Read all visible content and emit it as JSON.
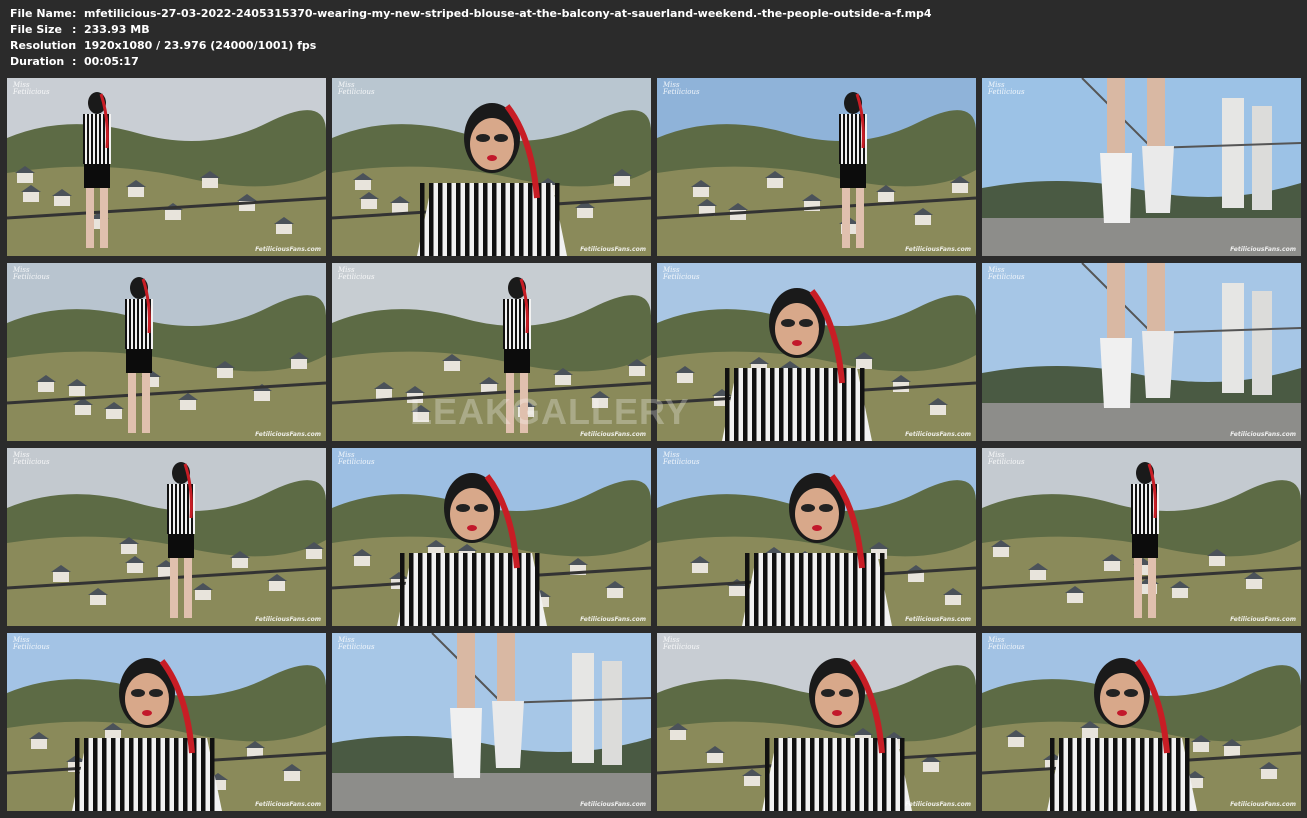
{
  "info": {
    "file_name": {
      "key": "File Name",
      "value": "mfetilicious-27-03-2022-2405315370-wearing-my-new-striped-blouse-at-the-balcony-at-sauerland-weekend.-the-people-outside-a-f.mp4"
    },
    "file_size": {
      "key": "File Size",
      "value": "233.93 MB"
    },
    "resolution": {
      "key": "Resolution",
      "value": "1920x1080 / 23.976 (24000/1001) fps"
    },
    "duration": {
      "key": "Duration",
      "value": "00:05:17"
    }
  },
  "colon": ":",
  "overlay_watermark": "LEAKGALLERY",
  "thumbnails": [
    {
      "scene": "village-wide",
      "logo": "Miss Fetilicious",
      "watermark": "FetiliciousFans.com",
      "sky": "#c9ced4"
    },
    {
      "scene": "closeup-face",
      "logo": "Miss Fetilicious",
      "watermark": "FetiliciousFans.com",
      "sky": "#b9c6d0"
    },
    {
      "scene": "standing-mid",
      "logo": "Miss Fetilicious",
      "watermark": "FetiliciousFans.com",
      "sky": "#8fb3d9"
    },
    {
      "scene": "heels-closeup",
      "logo": "Miss Fetilicious",
      "watermark": "FetiliciousFans.com",
      "sky": "#9cc2e6"
    },
    {
      "scene": "village-wide",
      "logo": "Miss Fetilicious",
      "watermark": "FetiliciousFans.com",
      "sky": "#b8c4cf"
    },
    {
      "scene": "village-wide",
      "logo": "Miss Fetilicious",
      "watermark": "FetiliciousFans.com",
      "sky": "#c7cdd2"
    },
    {
      "scene": "closeup-face",
      "logo": "Miss Fetilicious",
      "watermark": "FetiliciousFans.com",
      "sky": "#a9c6e4"
    },
    {
      "scene": "heels-closeup",
      "logo": "Miss Fetilicious",
      "watermark": "FetiliciousFans.com",
      "sky": "#a6c6e6"
    },
    {
      "scene": "village-wide",
      "logo": "Miss Fetilicious",
      "watermark": "FetiliciousFans.com",
      "sky": "#c3c9cf"
    },
    {
      "scene": "closeup-face",
      "logo": "Miss Fetilicious",
      "watermark": "FetiliciousFans.com",
      "sky": "#9dbfe3"
    },
    {
      "scene": "closeup-face",
      "logo": "Miss Fetilicious",
      "watermark": "FetiliciousFans.com",
      "sky": "#9ebfe2"
    },
    {
      "scene": "village-wide",
      "logo": "Miss Fetilicious",
      "watermark": "FetiliciousFans.com",
      "sky": "#c4cad0"
    },
    {
      "scene": "closeup-face",
      "logo": "Miss Fetilicious",
      "watermark": "FetiliciousFans.com",
      "sky": "#a3c3e5"
    },
    {
      "scene": "heels-closeup",
      "logo": "Miss Fetilicious",
      "watermark": "FetiliciousFans.com",
      "sky": "#a7c7e7"
    },
    {
      "scene": "closeup-face",
      "logo": "Miss Fetilicious",
      "watermark": "FetiliciousFans.com",
      "sky": "#c8cdd3"
    },
    {
      "scene": "closeup-face",
      "logo": "Miss Fetilicious",
      "watermark": "FetiliciousFans.com",
      "sky": "#a2c2e4"
    }
  ]
}
